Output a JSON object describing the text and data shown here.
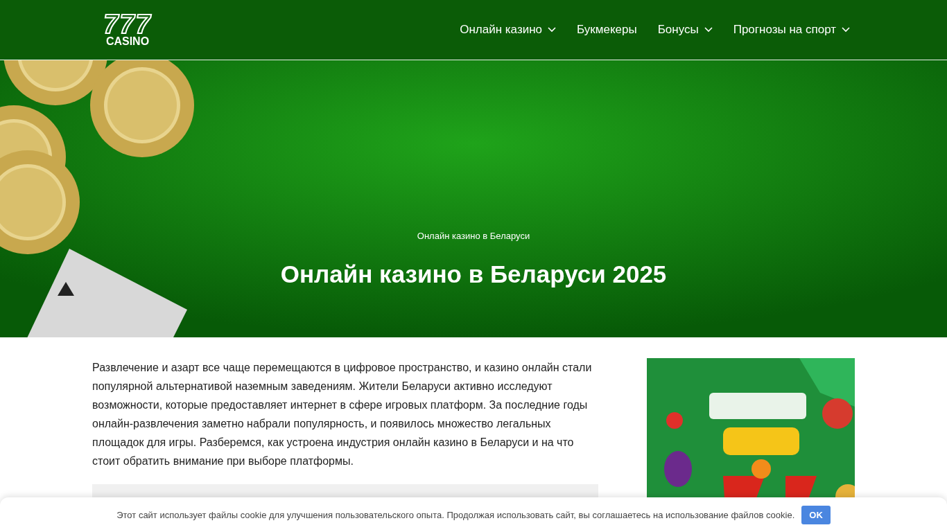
{
  "logo": {
    "number": "777",
    "word": "CASINO"
  },
  "nav": [
    {
      "label": "Онлайн казино",
      "has_dropdown": true
    },
    {
      "label": "Букмекеры",
      "has_dropdown": false
    },
    {
      "label": "Бонусы",
      "has_dropdown": true
    },
    {
      "label": "Прогнозы на спорт",
      "has_dropdown": true
    }
  ],
  "hero": {
    "breadcrumb": "Онлайн казино в Беларуси",
    "title": "Онлайн казино в Беларуси 2025"
  },
  "article": {
    "intro": "Развлечение и азарт все чаще перемещаются в цифровое пространство, и казино онлайн стали популярной альтернативой наземным заведениям. Жители Беларуси активно исследуют возможности, которые предоставляет интернет в сфере игровых платформ. За последние годы онлайн-развлечения заметно набрали популярность, и появилось множество легальных площадок для игры. Разберемся, как устроена индустрия онлайн казино в Беларуси и на что стоит обратить внимание при выборе платформы."
  },
  "cookie_bar": {
    "text": "Этот сайт использует файлы cookie для улучшения пользовательского опыта. Продолжая использовать сайт, вы соглашаетесь на использование файлов cookie.",
    "button": "OK"
  }
}
